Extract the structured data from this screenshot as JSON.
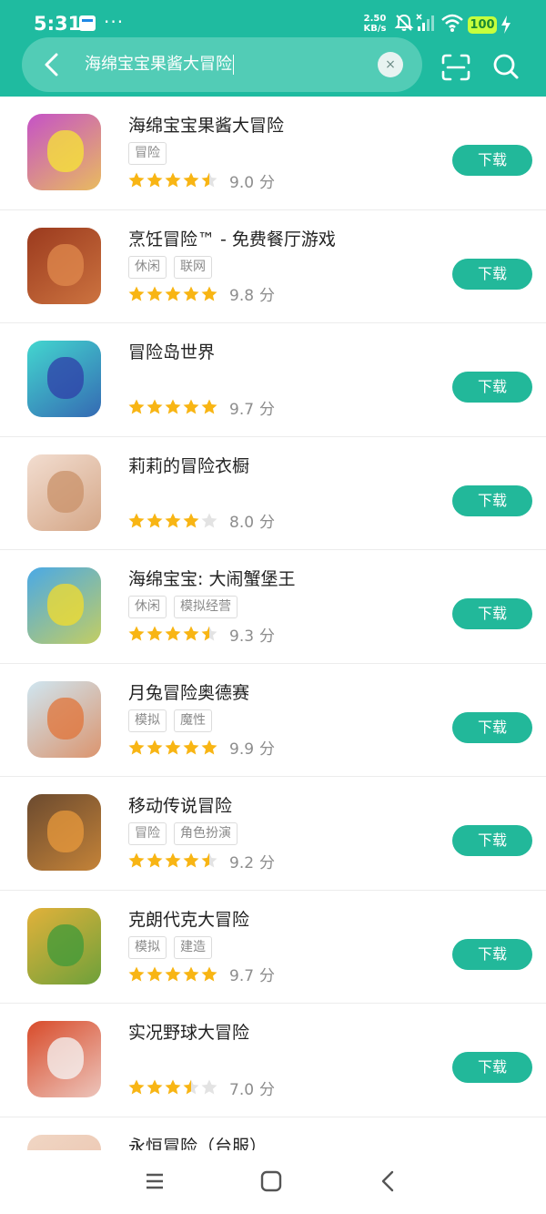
{
  "status": {
    "time": "5:31",
    "dots": "···",
    "net_speed_value": "2.50",
    "net_speed_unit": "KB/s",
    "battery": "100"
  },
  "search": {
    "query": "海绵宝宝果酱大冒险",
    "clear_glyph": "×"
  },
  "download_label": "下载",
  "score_unit": "分",
  "apps": [
    {
      "name": "海绵宝宝果酱大冒险",
      "tags": [
        "冒险"
      ],
      "stars": 4.5,
      "score": "9.0",
      "icon_bg": "#c552c7",
      "icon_accent": "#f7e535",
      "icon_name": "spongebob-jam-icon"
    },
    {
      "name": "烹饪冒险™ - 免费餐厅游戏",
      "tags": [
        "休闲",
        "联网"
      ],
      "stars": 5,
      "score": "9.8",
      "icon_bg": "#9b3a1e",
      "icon_accent": "#e08a4d",
      "icon_name": "cooking-adventure-icon"
    },
    {
      "name": "冒险岛世界",
      "tags": [],
      "stars": 5,
      "score": "9.7",
      "icon_bg": "#43d6cf",
      "icon_accent": "#2f3fa8",
      "icon_name": "maplestory-worlds-icon"
    },
    {
      "name": "莉莉的冒险衣橱",
      "tags": [],
      "stars": 4,
      "score": "8.0",
      "icon_bg": "#f2ddd0",
      "icon_accent": "#c9916a",
      "icon_name": "lily-wardrobe-icon"
    },
    {
      "name": "海绵宝宝: 大闹蟹堡王",
      "tags": [
        "休闲",
        "模拟经营"
      ],
      "stars": 4.5,
      "score": "9.3",
      "icon_bg": "#4aa9e6",
      "icon_accent": "#f3dc2e",
      "icon_name": "spongebob-krusty-icon"
    },
    {
      "name": "月兔冒险奥德赛",
      "tags": [
        "模拟",
        "魔性"
      ],
      "stars": 5,
      "score": "9.9",
      "icon_bg": "#cfe6f1",
      "icon_accent": "#e0743a",
      "icon_name": "moon-rabbit-icon"
    },
    {
      "name": "移动传说冒险",
      "tags": [
        "冒险",
        "角色扮演"
      ],
      "stars": 4.5,
      "score": "9.2",
      "icon_bg": "#6b4a2f",
      "icon_accent": "#e89a3c",
      "icon_name": "mobile-legends-adventure-icon"
    },
    {
      "name": "克朗代克大冒险",
      "tags": [
        "模拟",
        "建造"
      ],
      "stars": 5,
      "score": "9.7",
      "icon_bg": "#e2b13a",
      "icon_accent": "#3f9a3a",
      "icon_name": "klondike-adventure-icon"
    },
    {
      "name": "实况野球大冒险",
      "tags": [],
      "stars": 3.5,
      "score": "7.0",
      "icon_bg": "#d84b2a",
      "icon_accent": "#f5f5f5",
      "icon_name": "powerful-baseball-icon"
    },
    {
      "name": "永恒冒险（台服）",
      "tags": [],
      "stars": 0,
      "score": "",
      "icon_bg": "#f0d6c4",
      "icon_accent": "#e9b9a1",
      "icon_name": "eternal-adventure-icon"
    }
  ],
  "colors": {
    "brand": "#1fbba0",
    "button": "#22b89a",
    "star": "#f8b514",
    "star_empty": "#e3e3e3"
  }
}
